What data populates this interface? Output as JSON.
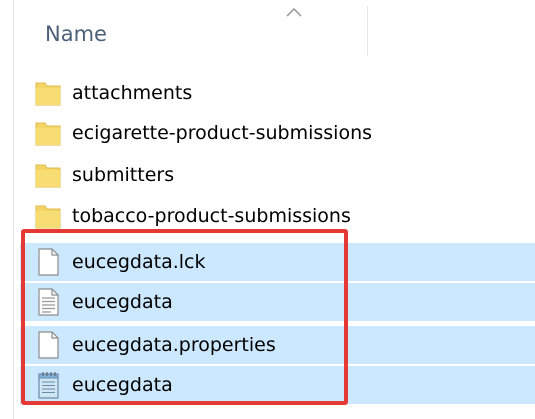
{
  "columns": {
    "name_header": "Name"
  },
  "colors": {
    "selection": "#cce8ff",
    "folder": "#f5d466",
    "annotation": "#e53935"
  },
  "files": [
    {
      "name": "attachments",
      "type": "folder",
      "icon": "folder-icon",
      "selected": false
    },
    {
      "name": "ecigarette-product-submissions",
      "type": "folder",
      "icon": "folder-icon",
      "selected": false
    },
    {
      "name": "submitters",
      "type": "folder",
      "icon": "folder-icon",
      "selected": false
    },
    {
      "name": "tobacco-product-submissions",
      "type": "folder",
      "icon": "folder-icon",
      "selected": false
    },
    {
      "name": "eucegdata.lck",
      "type": "file",
      "icon": "blank-file-icon",
      "selected": true
    },
    {
      "name": "eucegdata",
      "type": "file",
      "icon": "text-file-icon",
      "selected": true
    },
    {
      "name": "eucegdata.properties",
      "type": "file",
      "icon": "blank-file-icon",
      "selected": true
    },
    {
      "name": "eucegdata",
      "type": "file",
      "icon": "notepad-file-icon",
      "selected": true
    }
  ]
}
